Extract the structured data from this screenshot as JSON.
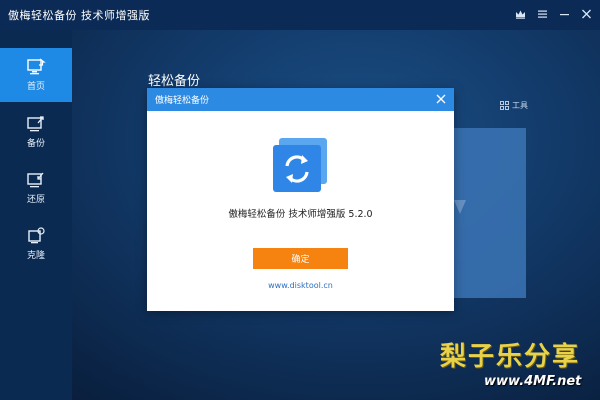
{
  "window": {
    "title": "傲梅轻松备份 技术师增强版",
    "buttons": [
      "crown-icon",
      "menu-icon",
      "minimize-icon",
      "close-icon"
    ]
  },
  "sidebar": {
    "items": [
      {
        "label": "首页",
        "icon": "home-icon",
        "active": true
      },
      {
        "label": "备份",
        "icon": "backup-icon",
        "active": false
      },
      {
        "label": "还原",
        "icon": "restore-icon",
        "active": false
      },
      {
        "label": "克隆",
        "icon": "clone-icon",
        "active": false
      }
    ]
  },
  "main": {
    "title": "轻松备份",
    "tools_label": "工具"
  },
  "dialog": {
    "title": "傲梅轻松备份",
    "version_text": "傲梅轻松备份 技术师增强版 5.2.0",
    "ok_label": "确定",
    "website": "www.disktool.cn"
  },
  "watermark": {
    "title": "梨子乐分享",
    "url": "www.4MF.net"
  },
  "colors": {
    "sidebar_active": "#1e8ae6",
    "dialog_header": "#2d8ae3",
    "ok_button": "#f6820f",
    "titlebar": "#0b2a55"
  }
}
